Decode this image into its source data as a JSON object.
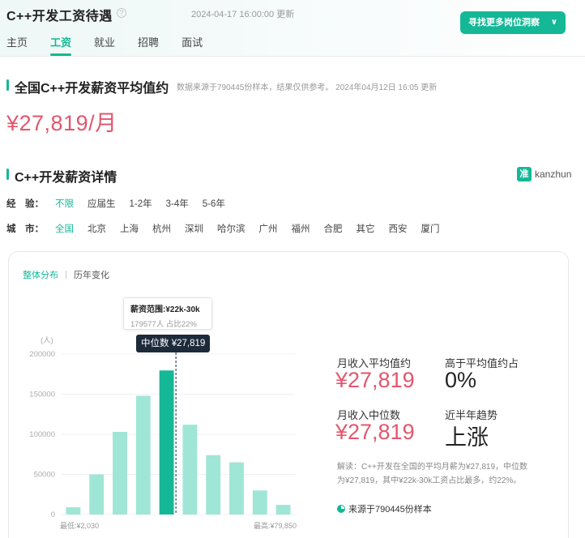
{
  "header": {
    "title": "C++开发工资待遇",
    "help_icon": "?",
    "update_time": "2024-04-17 16:00:00 更新",
    "cta_label": "寻找更多岗位洞察",
    "cta_icon": "chevron-down-icon",
    "tabs": [
      {
        "label": "主页",
        "active": false
      },
      {
        "label": "工资",
        "active": true
      },
      {
        "label": "就业",
        "active": false
      },
      {
        "label": "招聘",
        "active": false
      },
      {
        "label": "面试",
        "active": false
      }
    ]
  },
  "average": {
    "title": "全国C++开发薪资平均值约",
    "note": "数据来源于790445份样本，结果仅供参考。 2024年04月12日 16:05 更新",
    "value": "¥27,819/月"
  },
  "details": {
    "title": "C++开发薪资详情",
    "brand_mark": "准",
    "brand_name": "kanzhun",
    "filters": {
      "experience": {
        "label": "经　验：",
        "options": [
          "不限",
          "应届生",
          "1-2年",
          "3-4年",
          "5-6年"
        ],
        "active_index": 0
      },
      "city": {
        "label": "城　市：",
        "options": [
          "全国",
          "北京",
          "上海",
          "杭州",
          "深圳",
          "哈尔滨",
          "广州",
          "福州",
          "合肥",
          "其它",
          "西安",
          "厦门"
        ],
        "active_index": 0
      }
    }
  },
  "card": {
    "tabs": [
      "整体分布",
      "历年变化"
    ],
    "active_tab": 0,
    "tooltip": {
      "range": "薪资范围:¥22k-30k",
      "count": "179577人  占比22%"
    },
    "median_label": "中位数 ¥27,819",
    "stats": {
      "avg_label": "月收入平均值约",
      "avg_value": "¥27,819",
      "above_label": "高于平均值约占",
      "above_value": "0%",
      "median_label": "月收入中位数",
      "median_value": "¥27,819",
      "trend_label": "近半年趋势",
      "trend_value": "上涨"
    },
    "explain": "解读：C++开发在全国的平均月薪为¥27,819，中位数为¥27,819，其中¥22k-30k工资占比最多，约22%。",
    "source": "来源于790445份样本",
    "colors": {
      "accent": "#14b896",
      "bar": "#9fe6d6",
      "bar_highlight": "#14b896",
      "price": "#e3566d"
    }
  },
  "chart_data": {
    "type": "bar",
    "unit_label": "(人)",
    "yticks": [
      "200000",
      "150000",
      "100000",
      "50000",
      "0"
    ],
    "ylim": [
      0,
      200000
    ],
    "values": [
      9000,
      50000,
      103000,
      148000,
      179577,
      112000,
      74000,
      65000,
      30000,
      12000
    ],
    "highlight_index": 4,
    "min_label": "最低:¥2,030",
    "max_label": "最高:¥79,850",
    "median_position": 0.49
  }
}
